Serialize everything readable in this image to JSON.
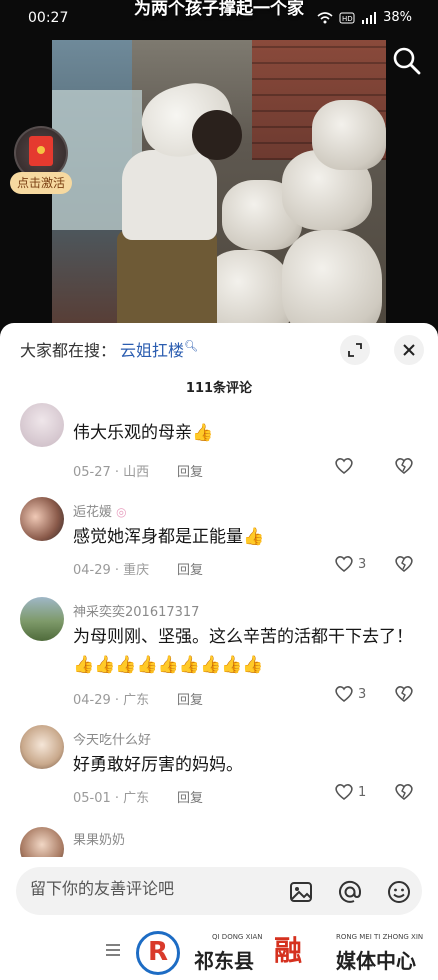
{
  "status_bar": {
    "time": "00:27",
    "battery": "38%"
  },
  "video": {
    "caption": "为两个孩子撑起一个家"
  },
  "red_packet": {
    "label": "点击激活"
  },
  "sheet": {
    "search_prefix": "大家都在搜：",
    "search_term": "云姐扛楼",
    "comment_count": "111条评论"
  },
  "comments": [
    {
      "name": "",
      "text": "伟大乐观的母亲👍",
      "date": "05-27 · 山西",
      "reply": "回复",
      "likes": ""
    },
    {
      "name": "逅花媛",
      "text": "感觉她浑身都是正能量👍",
      "date": "04-29 · 重庆",
      "reply": "回复",
      "likes": "3"
    },
    {
      "name": "神采奕奕201617317",
      "text": "为母则刚、坚强。这么辛苦的活都干下去了！👍👍👍👍👍👍👍👍👍",
      "date": "04-29 · 广东",
      "reply": "回复",
      "likes": "3"
    },
    {
      "name": "今天吃什么好",
      "text": "好勇敢好厉害的妈妈。",
      "date": "05-01 · 广东",
      "reply": "回复",
      "likes": "1"
    },
    {
      "name": "果果奶奶",
      "text": "",
      "date": "",
      "reply": "",
      "likes": ""
    }
  ],
  "input": {
    "placeholder": "留下你的友善评论吧"
  },
  "footer": {
    "pinyin_left": "QI DONG XIAN",
    "name_left": "祁东县",
    "seal": "融",
    "pinyin_right": "RONG MEI TI ZHONG XIN",
    "name_right": "媒体中心"
  },
  "colors": {
    "accent_link": "#2b5db0",
    "red_packet": "#e53a2f",
    "logo_blue": "#1d6cc4",
    "logo_red": "#d93a2b"
  }
}
